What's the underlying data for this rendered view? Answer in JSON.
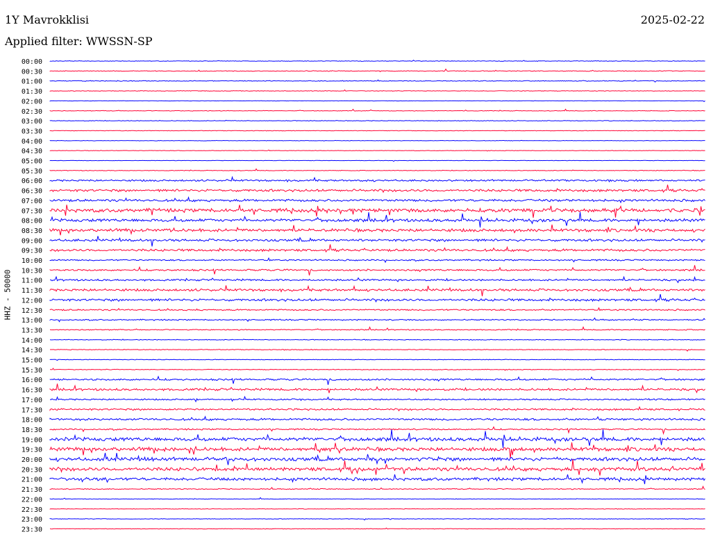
{
  "header": {
    "station": "1Y Mavrokklisi",
    "date": "2025-02-22",
    "filter": "Applied filter: WWSSN-SP"
  },
  "chart_data": {
    "type": "line",
    "title": "1Y Mavrokklisi",
    "ylabel": "HHZ - 50000",
    "colors": {
      "even_row": "#0000ff",
      "odd_row": "#ff0033",
      "background": "#ffffff"
    },
    "time_labels": [
      "00:00",
      "00:30",
      "01:00",
      "01:30",
      "02:00",
      "02:30",
      "03:00",
      "03:30",
      "04:00",
      "04:30",
      "05:00",
      "05:30",
      "06:00",
      "06:30",
      "07:00",
      "07:30",
      "08:00",
      "08:30",
      "09:00",
      "09:30",
      "10:00",
      "10:30",
      "11:00",
      "11:30",
      "12:00",
      "12:30",
      "13:00",
      "13:30",
      "14:00",
      "14:30",
      "15:00",
      "15:30",
      "16:00",
      "16:30",
      "17:00",
      "17:30",
      "18:00",
      "18:30",
      "19:00",
      "19:30",
      "20:00",
      "20:30",
      "21:00",
      "21:30",
      "22:00",
      "22:30",
      "23:00",
      "23:30"
    ],
    "relative_amplitude": [
      0.5,
      0.6,
      0.6,
      0.5,
      0.3,
      0.5,
      0.5,
      0.4,
      0.4,
      0.4,
      0.3,
      0.5,
      1.5,
      2.0,
      2.0,
      3.0,
      2.5,
      2.5,
      2.0,
      2.0,
      1.2,
      1.5,
      1.5,
      2.0,
      2.0,
      1.2,
      1.0,
      0.8,
      0.6,
      0.6,
      0.5,
      0.6,
      1.5,
      1.8,
      1.2,
      1.5,
      1.8,
      1.2,
      3.0,
      3.0,
      3.0,
      3.0,
      2.5,
      0.8,
      0.4,
      0.4,
      0.5,
      0.4
    ]
  }
}
